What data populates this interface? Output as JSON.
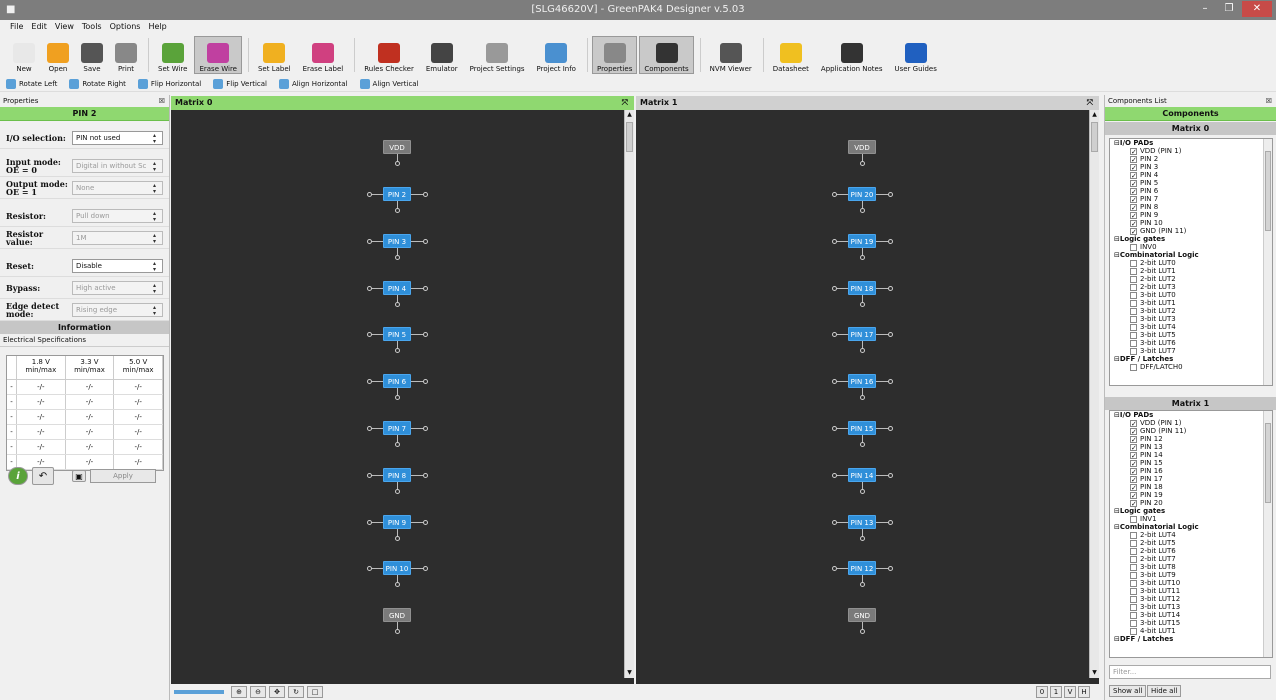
{
  "window": {
    "title": "[SLG46620V] - GreenPAK4 Designer v.5.03",
    "controls": [
      "–",
      "❐",
      "✕"
    ]
  },
  "menu": [
    "File",
    "Edit",
    "View",
    "Tools",
    "Options",
    "Help"
  ],
  "toolbar": [
    {
      "label": "New",
      "icon": "new-file-icon",
      "color": "#e8e8e8"
    },
    {
      "label": "Open",
      "icon": "open-folder-icon",
      "color": "#f0a020"
    },
    {
      "label": "Save",
      "icon": "save-disk-icon",
      "color": "#555555"
    },
    {
      "label": "Print",
      "icon": "printer-icon",
      "color": "#888888"
    },
    {
      "label": "Set Wire",
      "icon": "set-wire-icon",
      "color": "#5aa33a"
    },
    {
      "label": "Erase Wire",
      "icon": "erase-wire-icon",
      "color": "#c040a0",
      "active": true
    },
    {
      "label": "Set Label",
      "icon": "set-label-icon",
      "color": "#f0b020"
    },
    {
      "label": "Erase Label",
      "icon": "erase-label-icon",
      "color": "#d04080"
    },
    {
      "label": "Rules Checker",
      "icon": "ladybug-icon",
      "color": "#c03020"
    },
    {
      "label": "Emulator",
      "icon": "joystick-icon",
      "color": "#444444"
    },
    {
      "label": "Project Settings",
      "icon": "tools-icon",
      "color": "#999999"
    },
    {
      "label": "Project Info",
      "icon": "info-doc-icon",
      "color": "#4a90d0"
    },
    {
      "label": "Properties",
      "icon": "properties-icon",
      "color": "#888888",
      "active": true
    },
    {
      "label": "Components",
      "icon": "chip-icon",
      "color": "#333333",
      "active": true
    },
    {
      "label": "NVM Viewer",
      "icon": "grid-icon",
      "color": "#555555"
    },
    {
      "label": "Datasheet",
      "icon": "datasheet-icon",
      "color": "#f0c020"
    },
    {
      "label": "Application Notes",
      "icon": "app-notes-icon",
      "color": "#333333"
    },
    {
      "label": "User Guides",
      "icon": "user-guides-icon",
      "color": "#2060c0"
    }
  ],
  "toolbar2": [
    "Rotate Left",
    "Rotate Right",
    "Flip Horizontal",
    "Flip Vertical",
    "Align Horizontal",
    "Align Vertical"
  ],
  "properties": {
    "panel_title": "Properties",
    "pin_header": "PIN 2",
    "io_label": "I/O selection:",
    "io_value": "PIN not used",
    "input_label": "Input mode:\nOE = 0",
    "input_value": "Digital in without Sc",
    "output_label": "Output mode:\nOE = 1",
    "output_value": "None",
    "resistor_label": "Resistor:",
    "resistor_value": "Pull down",
    "resval_label": "Resistor value:",
    "resval_value": "1M",
    "reset_label": "Reset:",
    "reset_value": "Disable",
    "bypass_label": "Bypass:",
    "bypass_value": "High active",
    "edge_label": "Edge detect mode:",
    "edge_value": "Rising edge",
    "info_header": "Information",
    "elec_spec": "Electrical Specifications",
    "spec_cols": [
      "1.8 V\nmin/max",
      "3.3 V\nmin/max",
      "5.0 V\nmin/max"
    ],
    "spec_rows": [
      [
        "-",
        "-/-",
        "-/-",
        "-/-"
      ],
      [
        "-",
        "-/-",
        "-/-",
        "-/-"
      ],
      [
        "-",
        "-/-",
        "-/-",
        "-/-"
      ],
      [
        "-",
        "-/-",
        "-/-",
        "-/-"
      ],
      [
        "-",
        "-/-",
        "-/-",
        "-/-"
      ],
      [
        "-",
        "-/-",
        "-/-",
        "-/-"
      ]
    ],
    "apply": "Apply"
  },
  "matrix0": {
    "title": "Matrix 0",
    "header_color": "#8fd870",
    "top": "VDD",
    "pins": [
      "PIN 2",
      "PIN 3",
      "PIN 4",
      "PIN 5",
      "PIN 6",
      "PIN 7",
      "PIN 8",
      "PIN 9",
      "PIN 10"
    ],
    "bottom": "GND"
  },
  "matrix1": {
    "title": "Matrix 1",
    "header_color": "#d0d0d0",
    "top": "VDD",
    "pins": [
      "PIN 20",
      "PIN 19",
      "PIN 18",
      "PIN 17",
      "PIN 16",
      "PIN 15",
      "PIN 14",
      "PIN 13",
      "PIN 12"
    ],
    "bottom": "GND"
  },
  "pages": [
    "0",
    "1",
    "V",
    "H"
  ],
  "components": {
    "panel_title": "Components List",
    "header": "Components",
    "m0_title": "Matrix 0",
    "m0_items": [
      {
        "cat": "I/O PADs"
      },
      {
        "n": "VDD (PIN 1)",
        "c": true
      },
      {
        "n": "PIN 2",
        "c": true
      },
      {
        "n": "PIN 3",
        "c": true
      },
      {
        "n": "PIN 4",
        "c": true
      },
      {
        "n": "PIN 5",
        "c": true
      },
      {
        "n": "PIN 6",
        "c": true
      },
      {
        "n": "PIN 7",
        "c": true
      },
      {
        "n": "PIN 8",
        "c": true
      },
      {
        "n": "PIN 9",
        "c": true
      },
      {
        "n": "PIN 10",
        "c": true
      },
      {
        "n": "GND (PIN 11)",
        "c": true
      },
      {
        "cat": "Logic gates"
      },
      {
        "n": "INV0",
        "c": false
      },
      {
        "cat": "Combinatorial Logic"
      },
      {
        "n": "2-bit LUT0",
        "c": false
      },
      {
        "n": "2-bit LUT1",
        "c": false
      },
      {
        "n": "2-bit LUT2",
        "c": false
      },
      {
        "n": "2-bit LUT3",
        "c": false
      },
      {
        "n": "3-bit LUT0",
        "c": false
      },
      {
        "n": "3-bit LUT1",
        "c": false
      },
      {
        "n": "3-bit LUT2",
        "c": false
      },
      {
        "n": "3-bit LUT3",
        "c": false
      },
      {
        "n": "3-bit LUT4",
        "c": false
      },
      {
        "n": "3-bit LUT5",
        "c": false
      },
      {
        "n": "3-bit LUT6",
        "c": false
      },
      {
        "n": "3-bit LUT7",
        "c": false
      },
      {
        "cat": "DFF / Latches"
      },
      {
        "n": "DFF/LATCH0",
        "c": false
      }
    ],
    "m1_title": "Matrix 1",
    "m1_items": [
      {
        "cat": "I/O PADs"
      },
      {
        "n": "VDD (PIN 1)",
        "c": true
      },
      {
        "n": "GND (PIN 11)",
        "c": true
      },
      {
        "n": "PIN 12",
        "c": true
      },
      {
        "n": "PIN 13",
        "c": true
      },
      {
        "n": "PIN 14",
        "c": true
      },
      {
        "n": "PIN 15",
        "c": true
      },
      {
        "n": "PIN 16",
        "c": true
      },
      {
        "n": "PIN 17",
        "c": true
      },
      {
        "n": "PIN 18",
        "c": true
      },
      {
        "n": "PIN 19",
        "c": true
      },
      {
        "n": "PIN 20",
        "c": true
      },
      {
        "cat": "Logic gates"
      },
      {
        "n": "INV1",
        "c": false
      },
      {
        "cat": "Combinatorial Logic"
      },
      {
        "n": "2-bit LUT4",
        "c": false
      },
      {
        "n": "2-bit LUT5",
        "c": false
      },
      {
        "n": "2-bit LUT6",
        "c": false
      },
      {
        "n": "2-bit LUT7",
        "c": false
      },
      {
        "n": "3-bit LUT8",
        "c": false
      },
      {
        "n": "3-bit LUT9",
        "c": false
      },
      {
        "n": "3-bit LUT10",
        "c": false
      },
      {
        "n": "3-bit LUT11",
        "c": false
      },
      {
        "n": "3-bit LUT12",
        "c": false
      },
      {
        "n": "3-bit LUT13",
        "c": false
      },
      {
        "n": "3-bit LUT14",
        "c": false
      },
      {
        "n": "3-bit LUT15",
        "c": false
      },
      {
        "n": "4-bit LUT1",
        "c": false
      },
      {
        "cat": "DFF / Latches"
      }
    ],
    "filter_placeholder": "Filter...",
    "show_all": "Show all",
    "hide_all": "Hide all"
  }
}
